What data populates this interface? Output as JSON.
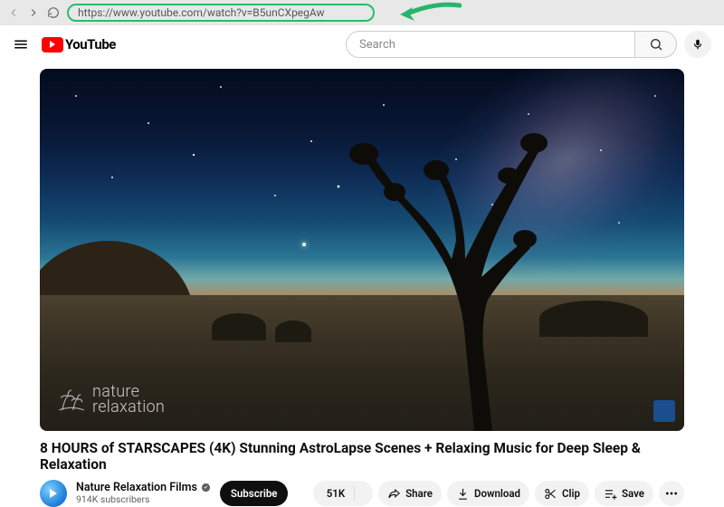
{
  "browser": {
    "url": "https://www.youtube.com/watch?v=B5unCXpegAw"
  },
  "header": {
    "logo_text": "YouTube",
    "search_placeholder": "Search"
  },
  "video": {
    "title": "8 HOURS of STARSCAPES (4K) Stunning AstroLapse Scenes + Relaxing Music for Deep Sleep & Relaxation",
    "watermark_line1": "nature",
    "watermark_line2": "relaxation"
  },
  "channel": {
    "name": "Nature Relaxation Films",
    "subscribers": "914K subscribers"
  },
  "actions": {
    "subscribe": "Subscribe",
    "likes": "51K",
    "share": "Share",
    "download": "Download",
    "clip": "Clip",
    "save": "Save"
  }
}
